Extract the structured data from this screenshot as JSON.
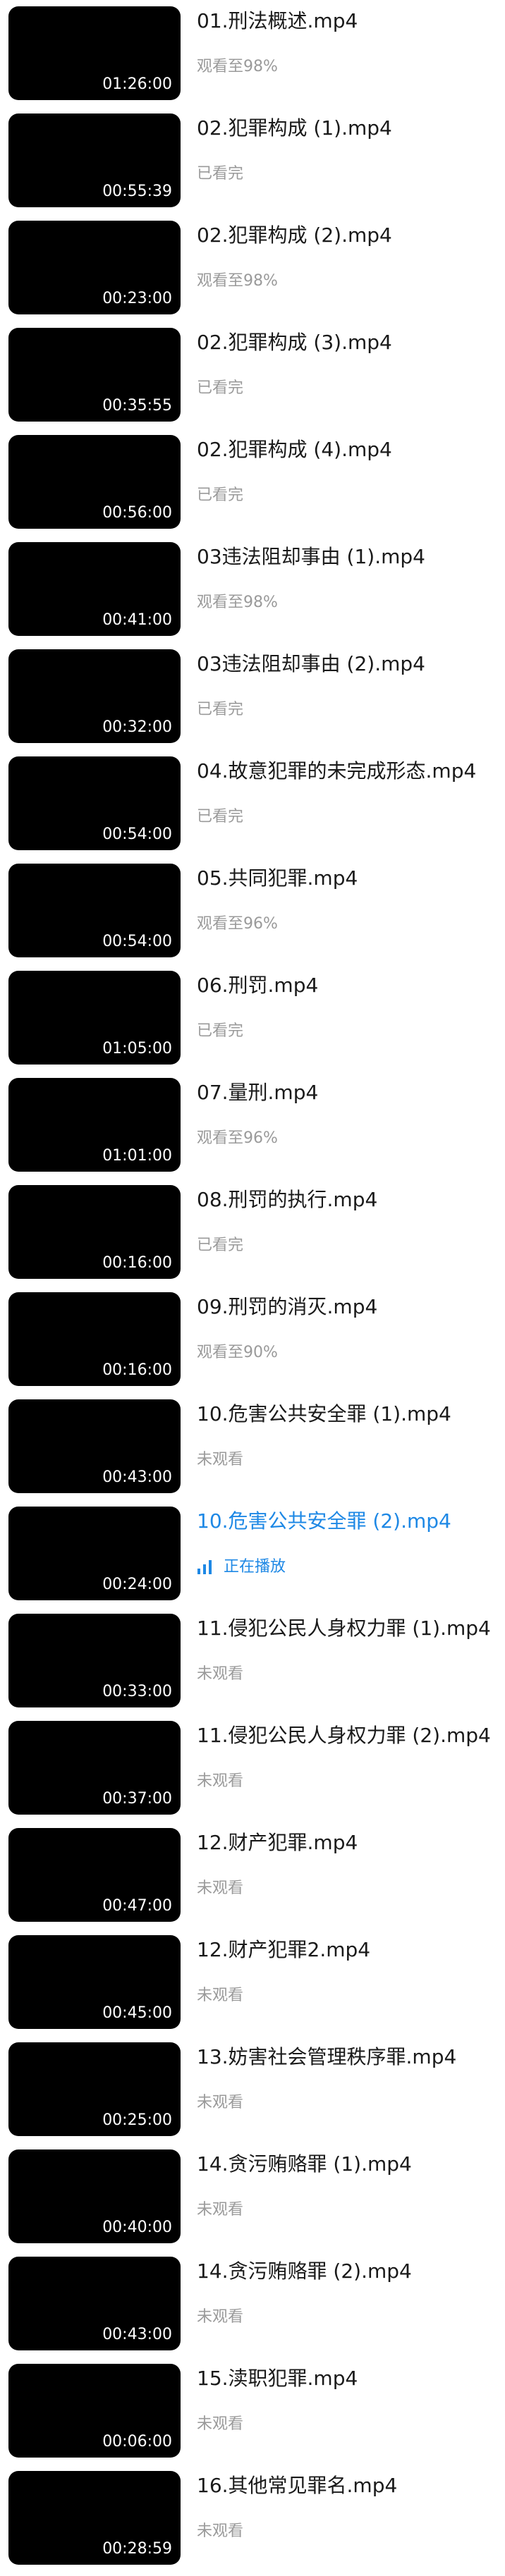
{
  "accent_color": "#1e88e5",
  "playlist": [
    {
      "title": "01.刑法概述.mp4",
      "duration": "01:26:00",
      "status": "观看至98%"
    },
    {
      "title": "02.犯罪构成 (1).mp4",
      "duration": "00:55:39",
      "status": "已看完"
    },
    {
      "title": "02.犯罪构成 (2).mp4",
      "duration": "00:23:00",
      "status": "观看至98%"
    },
    {
      "title": "02.犯罪构成 (3).mp4",
      "duration": "00:35:55",
      "status": "已看完"
    },
    {
      "title": "02.犯罪构成 (4).mp4",
      "duration": "00:56:00",
      "status": "已看完"
    },
    {
      "title": "03违法阻却事由 (1).mp4",
      "duration": "00:41:00",
      "status": "观看至98%"
    },
    {
      "title": "03违法阻却事由 (2).mp4",
      "duration": "00:32:00",
      "status": "已看完"
    },
    {
      "title": "04.故意犯罪的未完成形态.mp4",
      "duration": "00:54:00",
      "status": "已看完"
    },
    {
      "title": "05.共同犯罪.mp4",
      "duration": "00:54:00",
      "status": "观看至96%"
    },
    {
      "title": "06.刑罚.mp4",
      "duration": "01:05:00",
      "status": "已看完"
    },
    {
      "title": "07.量刑.mp4",
      "duration": "01:01:00",
      "status": "观看至96%"
    },
    {
      "title": "08.刑罚的执行.mp4",
      "duration": "00:16:00",
      "status": "已看完"
    },
    {
      "title": "09.刑罚的消灭.mp4",
      "duration": "00:16:00",
      "status": "观看至90%"
    },
    {
      "title": "10.危害公共安全罪 (1).mp4",
      "duration": "00:43:00",
      "status": "未观看"
    },
    {
      "title": "10.危害公共安全罪 (2).mp4",
      "duration": "00:24:00",
      "status": "正在播放",
      "active": true,
      "icon": "playing-bars-icon"
    },
    {
      "title": "11.侵犯公民人身权力罪 (1).mp4",
      "duration": "00:33:00",
      "status": "未观看"
    },
    {
      "title": "11.侵犯公民人身权力罪 (2).mp4",
      "duration": "00:37:00",
      "status": "未观看"
    },
    {
      "title": "12.财产犯罪.mp4",
      "duration": "00:47:00",
      "status": "未观看"
    },
    {
      "title": "12.财产犯罪2.mp4",
      "duration": "00:45:00",
      "status": "未观看"
    },
    {
      "title": "13.妨害社会管理秩序罪.mp4",
      "duration": "00:25:00",
      "status": "未观看"
    },
    {
      "title": "14.贪污贿赂罪 (1).mp4",
      "duration": "00:40:00",
      "status": "未观看"
    },
    {
      "title": "14.贪污贿赂罪 (2).mp4",
      "duration": "00:43:00",
      "status": "未观看"
    },
    {
      "title": "15.渎职犯罪.mp4",
      "duration": "00:06:00",
      "status": "未观看"
    },
    {
      "title": "16.其他常见罪名.mp4",
      "duration": "00:28:59",
      "status": "未观看"
    }
  ]
}
